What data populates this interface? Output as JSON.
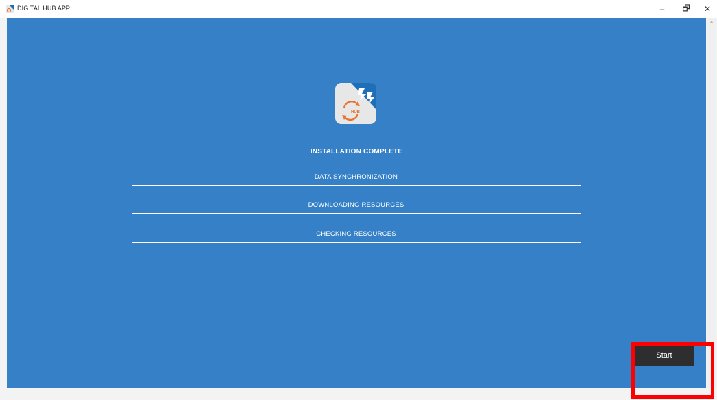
{
  "window": {
    "title": "DIGITAL HUB APP",
    "icon": "app-logo-icon",
    "controls": {
      "minimize": "–",
      "maximize": "🗗",
      "close": "✕"
    }
  },
  "logo": {
    "badge_text": "HUB",
    "icon": "digital-hub-logo-icon",
    "colors": {
      "orange": "#e8732f",
      "blue": "#1f6fb8",
      "tile": "#e7e7e7"
    }
  },
  "main": {
    "heading": "INSTALLATION COMPLETE",
    "steps": [
      {
        "label": "DATA SYNCHRONIZATION"
      },
      {
        "label": "DOWNLOADING RESOURCES"
      },
      {
        "label": "CHECKING RESOURCES"
      }
    ],
    "start_label": "Start"
  },
  "colors": {
    "panel_background": "#3580c7",
    "button_background": "#2e2e2e",
    "highlight": "#ff0000"
  }
}
